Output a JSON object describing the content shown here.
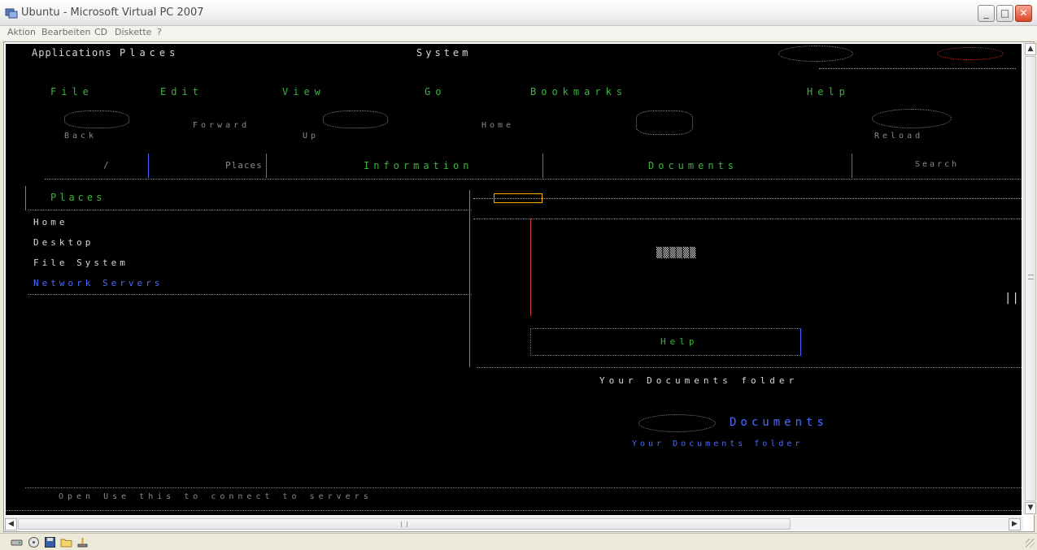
{
  "window": {
    "title": "Ubuntu - Microsoft Virtual PC 2007",
    "buttons": {
      "minimize": "_",
      "maximize": "□",
      "close": "✕"
    }
  },
  "menubar": {
    "items": [
      "Aktion",
      "Bearbeiten",
      "CD",
      "Diskette",
      "?"
    ]
  },
  "vm_screen": {
    "top_menu": [
      "Applications",
      "Places",
      "System"
    ],
    "nautilus_menu": [
      "File",
      "Edit",
      "View",
      "Go",
      "Bookmarks",
      "Help"
    ],
    "toolbar": [
      "Back",
      "Forward",
      "Up",
      "Home",
      "Reload"
    ],
    "location_bar": [
      "/",
      "Places",
      "Information",
      "Documents",
      "Search"
    ],
    "sidebar_items": [
      "Places",
      "Home",
      "Desktop",
      "File System",
      "Network Servers"
    ],
    "content_label": "Help",
    "footer_text": "Open Use this to connect to servers",
    "right_heading": "Documents",
    "right_subtext": "Your Documents folder"
  },
  "status_icons": [
    "harddisk-icon",
    "cd-icon",
    "floppy-icon",
    "folder-icon",
    "network-icon"
  ]
}
